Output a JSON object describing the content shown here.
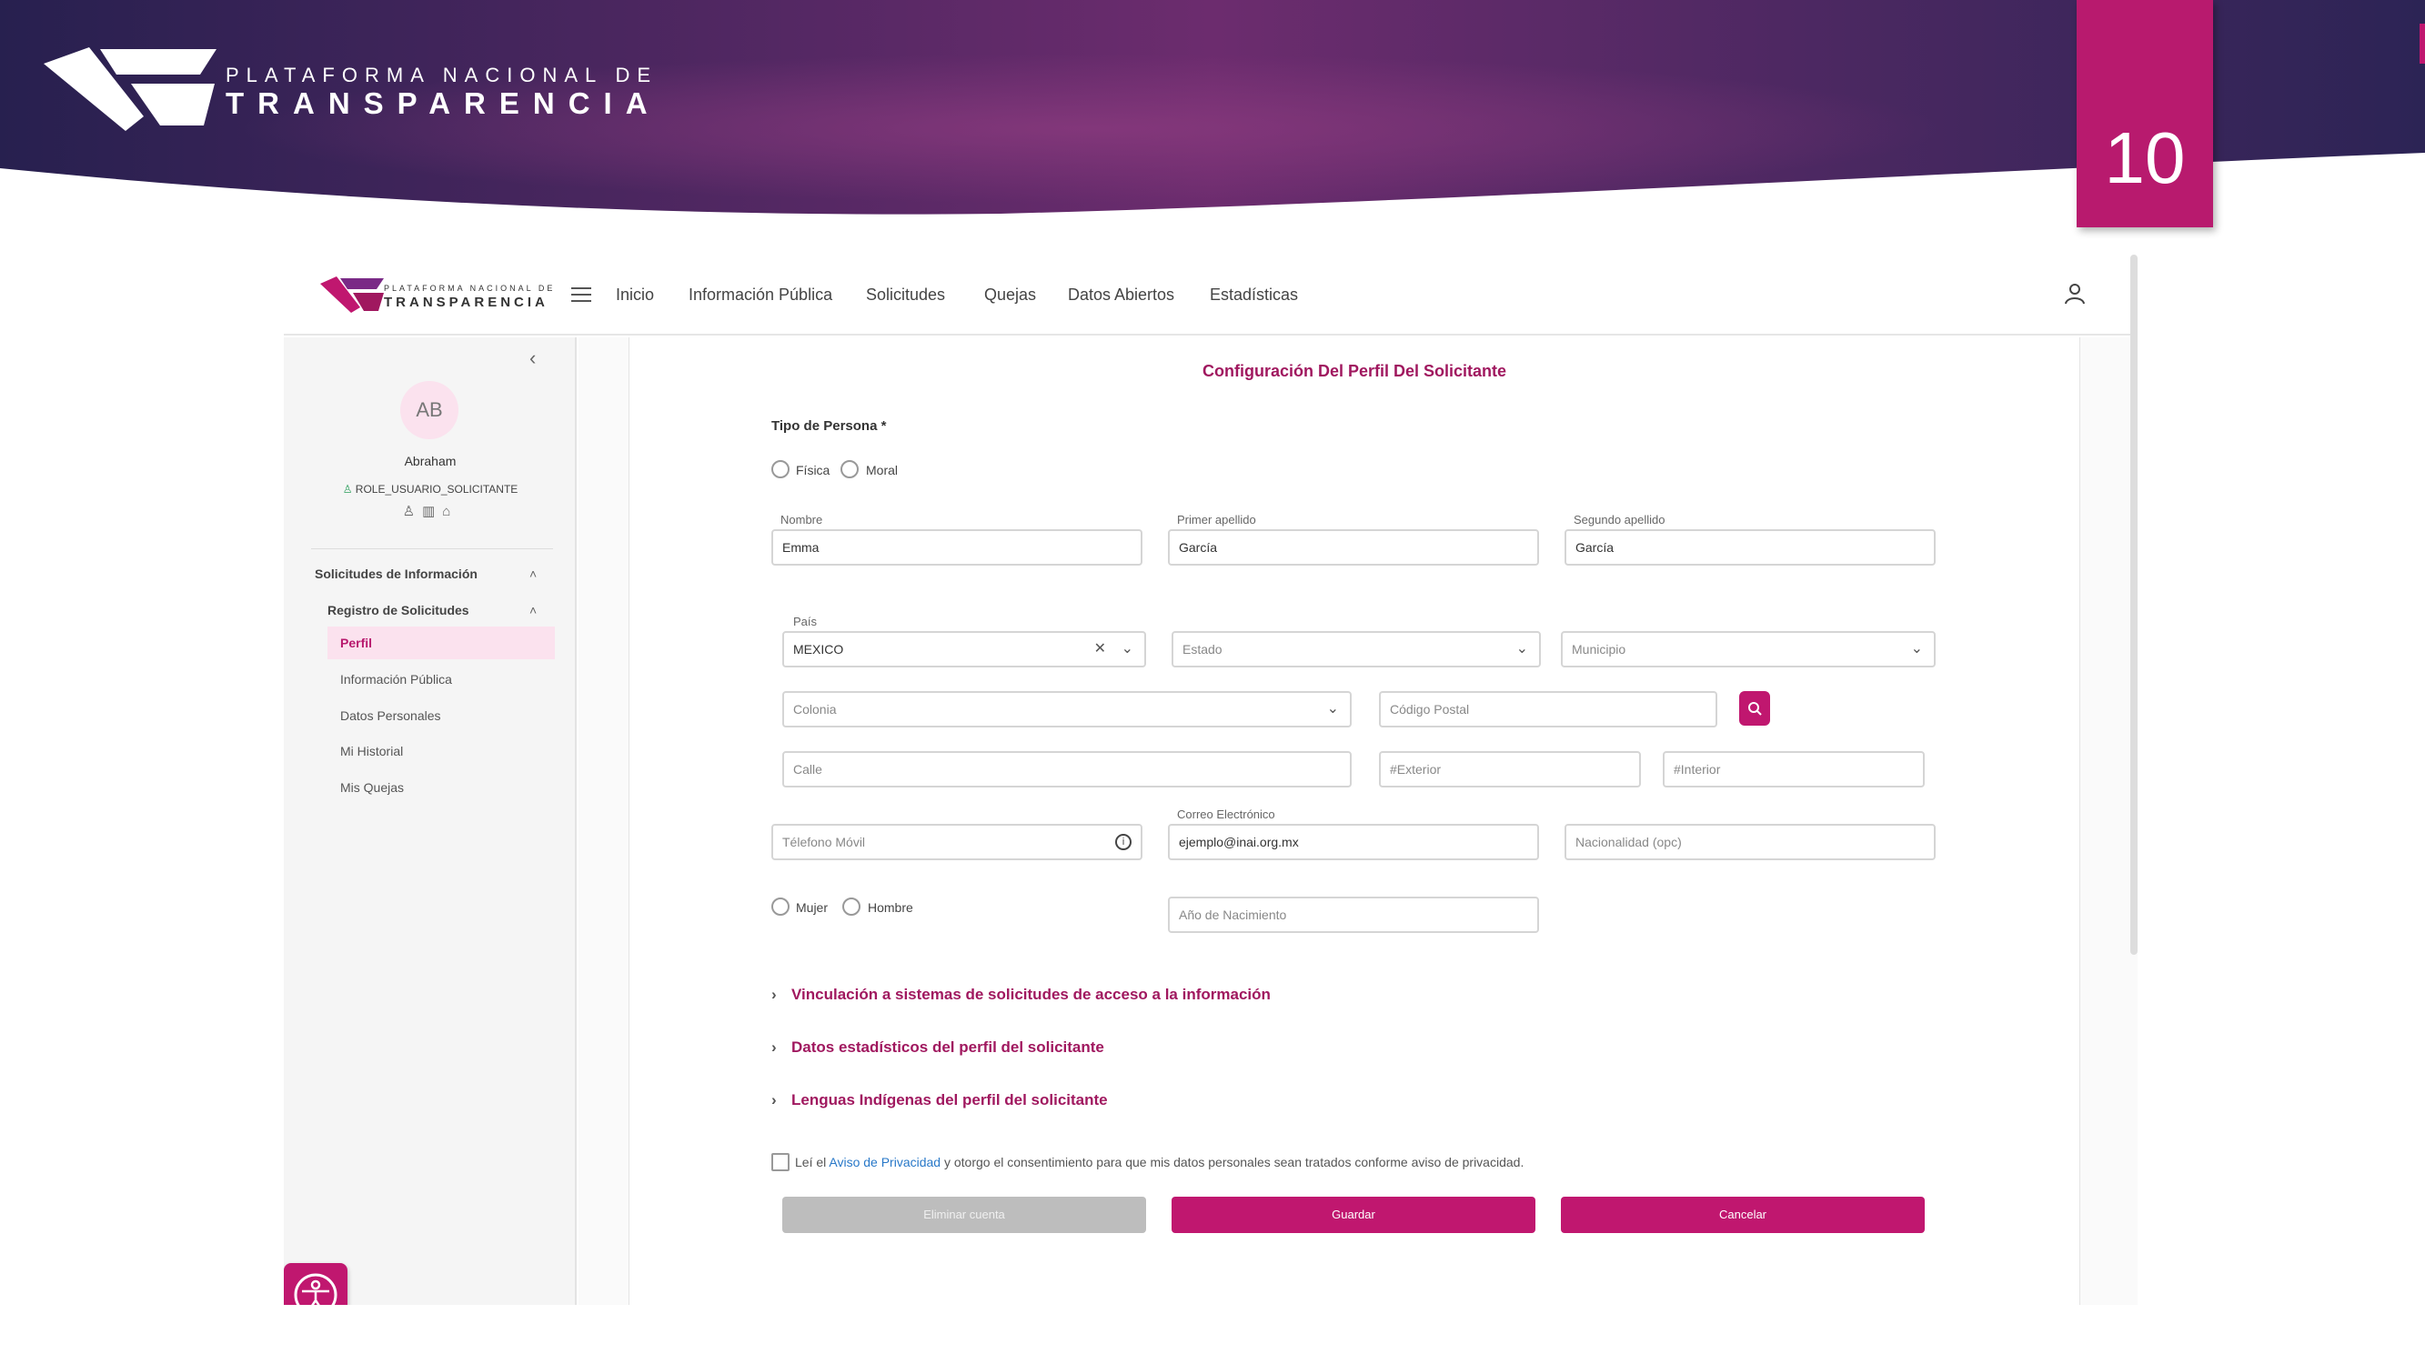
{
  "banner": {
    "line1": "PLATAFORMA NACIONAL DE",
    "line2": "TRANSPARENCIA",
    "slide_number": "10",
    "logo_icon": "pnt-logo-icon"
  },
  "colors": {
    "accent": "#c0176f",
    "banner_dark": "#2a1f55",
    "banner_purple": "#6a2a6e"
  },
  "app": {
    "logo": {
      "line1": "PLATAFORMA NACIONAL DE",
      "line2": "TRANSPARENCIA"
    },
    "nav": [
      "Inicio",
      "Información Pública",
      "Solicitudes",
      "Quejas",
      "Datos Abiertos",
      "Estadísticas"
    ],
    "sidebar": {
      "avatar_initials": "AB",
      "user_name": "Abraham",
      "role": "ROLE_USUARIO_SOLICITANTE",
      "section_title": "Solicitudes de Información",
      "subsection_title": "Registro de Solicitudes",
      "items": [
        "Perfil",
        "Información Pública",
        "Datos Personales",
        "Mi Historial",
        "Mis Quejas"
      ],
      "active_item": "Perfil"
    },
    "form": {
      "title": "Configuración Del Perfil Del Solicitante",
      "tipo_persona_label": "Tipo de Persona *",
      "tipo_persona_options": [
        "Física",
        "Moral"
      ],
      "nombre": {
        "label": "Nombre",
        "value": "Emma"
      },
      "primer_apellido": {
        "label": "Primer apellido",
        "value": "García"
      },
      "segundo_apellido": {
        "label": "Segundo apellido",
        "value": "García"
      },
      "pais": {
        "label": "País",
        "value": "MEXICO"
      },
      "estado": {
        "placeholder": "Estado"
      },
      "municipio": {
        "placeholder": "Municipio"
      },
      "colonia": {
        "placeholder": "Colonia"
      },
      "codigo_postal": {
        "placeholder": "Código Postal"
      },
      "calle": {
        "placeholder": "Calle"
      },
      "exterior": {
        "placeholder": "#Exterior"
      },
      "interior": {
        "placeholder": "#Interior"
      },
      "telefono": {
        "placeholder": "Télefono Móvil"
      },
      "correo": {
        "label": "Correo Electrónico",
        "value": "ejemplo@inai.org.mx"
      },
      "nacionalidad": {
        "placeholder": "Nacionalidad (opc)"
      },
      "sexo_options": [
        "Mujer",
        "Hombre"
      ],
      "anio_nacimiento": {
        "placeholder": "Año de Nacimiento"
      },
      "sections": [
        "Vinculación a sistemas de solicitudes de acceso a la información",
        "Datos estadísticos del perfil del solicitante",
        "Lenguas Indígenas del perfil del solicitante"
      ],
      "consent": {
        "prefix": "Leí el ",
        "link": "Aviso de Privacidad",
        "suffix": " y otorgo el consentimiento para que mis datos personales sean tratados conforme aviso de privacidad."
      },
      "buttons": {
        "delete": "Eliminar cuenta",
        "save": "Guardar",
        "cancel": "Cancelar"
      }
    }
  }
}
